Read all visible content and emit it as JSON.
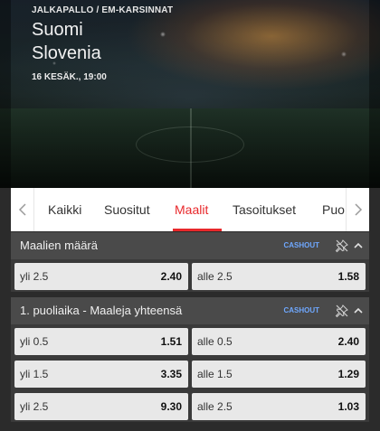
{
  "event": {
    "breadcrumb": "JALKAPALLO / EM-KARSINNAT",
    "home_team": "Suomi",
    "away_team": "Slovenia",
    "date": "16 KESÄK., 19:00"
  },
  "tabs": [
    {
      "label": "Kaikki",
      "active": false
    },
    {
      "label": "Suositut",
      "active": false
    },
    {
      "label": "Maalit",
      "active": true
    },
    {
      "label": "Tasoitukset",
      "active": false
    },
    {
      "label": "Puo",
      "active": false
    }
  ],
  "icons": {
    "tab_prev": "chevron-left-icon",
    "tab_next": "chevron-right-icon",
    "pin": "pin-icon",
    "collapse": "chevron-up-icon"
  },
  "colors": {
    "accent": "#e8282b",
    "cashout": "#6fa8ff"
  },
  "markets": [
    {
      "title": "Maalien määrä",
      "cashout_label": "CASHOUT",
      "rows": [
        {
          "left_label": "yli 2.5",
          "left_odds": "2.40",
          "right_label": "alle 2.5",
          "right_odds": "1.58"
        }
      ]
    },
    {
      "title": "1. puoliaika - Maaleja yhteensä",
      "cashout_label": "CASHOUT",
      "rows": [
        {
          "left_label": "yli 0.5",
          "left_odds": "1.51",
          "right_label": "alle 0.5",
          "right_odds": "2.40"
        },
        {
          "left_label": "yli 1.5",
          "left_odds": "3.35",
          "right_label": "alle 1.5",
          "right_odds": "1.29"
        },
        {
          "left_label": "yli 2.5",
          "left_odds": "9.30",
          "right_label": "alle 2.5",
          "right_odds": "1.03"
        }
      ]
    }
  ]
}
